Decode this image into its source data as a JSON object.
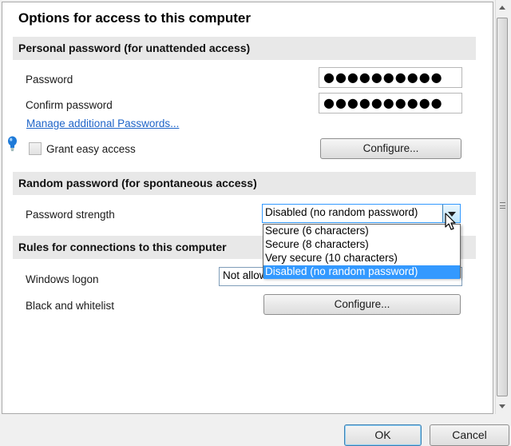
{
  "dialog": {
    "title": "Options for access to this computer"
  },
  "personal": {
    "header": "Personal password (for unattended access)",
    "password_label": "Password",
    "password_value": "●●●●●●●●●●",
    "confirm_label": "Confirm password",
    "confirm_value": "●●●●●●●●●●",
    "manage_link": "Manage additional Passwords...",
    "easy_access_label": "Grant easy access",
    "configure_label": "Configure..."
  },
  "random": {
    "header": "Random password (for spontaneous access)",
    "strength_label": "Password strength",
    "strength_value": "Disabled (no random password)",
    "options": [
      "Secure (6 characters)",
      "Secure (8 characters)",
      "Very secure (10 characters)",
      "Disabled (no random password)"
    ],
    "selected_index": 3
  },
  "rules": {
    "header": "Rules for connections to this computer",
    "windows_logon_label": "Windows logon",
    "windows_logon_value": "Not allowed",
    "blacklist_label": "Black and whitelist",
    "configure_label": "Configure..."
  },
  "footer": {
    "ok_label": "OK",
    "cancel_label": "Cancel"
  },
  "colors": {
    "accent": "#3399ff",
    "link": "#1e64c8",
    "header_bg": "#e8e8e8",
    "bulb": "#1e7ad8"
  },
  "icons": [
    "lightbulb-icon",
    "combo-arrow-icon",
    "mouse-cursor-icon",
    "scroll-up-icon",
    "scroll-down-icon"
  ]
}
